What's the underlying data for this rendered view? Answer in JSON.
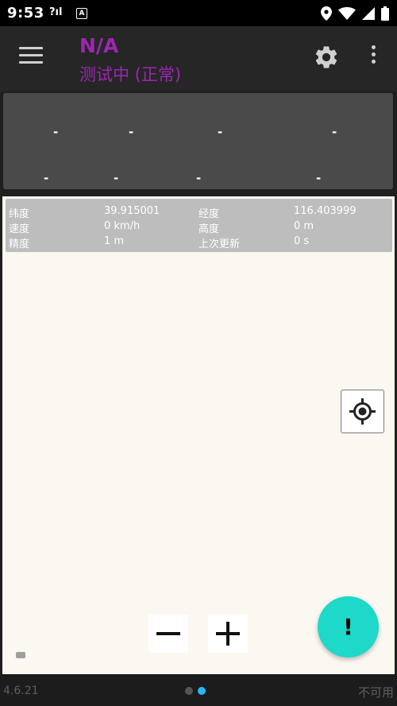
{
  "status_bar": {
    "time": "9:53",
    "signal_label": "?ıl",
    "app_indicator": "A",
    "icons": [
      "location-pin-icon",
      "wifi-icon",
      "cell-signal-icon",
      "battery-icon"
    ]
  },
  "app_bar": {
    "title": "N/A",
    "subtitle": "测试中 (正常)",
    "title_color": "#9c27b0",
    "icons": [
      "menu-icon",
      "gear-icon",
      "more-vert-icon"
    ]
  },
  "stats": {
    "top_values": [
      "-",
      "-",
      "-",
      "-"
    ],
    "bottom_values": [
      "-",
      "-",
      "-",
      "-"
    ]
  },
  "location_info": {
    "latitude_label": "纬度",
    "latitude_value": "39.915001",
    "longitude_label": "经度",
    "longitude_value": "116.403999",
    "speed_label": "速度",
    "speed_value": "0 km/h",
    "altitude_label": "高度",
    "altitude_value": "0 m",
    "accuracy_label": "精度",
    "accuracy_value": "1 m",
    "last_update_label": "上次更新",
    "last_update_value": "0 s"
  },
  "map_controls": {
    "zoom_out": "−",
    "zoom_in": "+",
    "alert_label": "!",
    "fab_color": "#1ed8c9"
  },
  "bottom_bar": {
    "version": "4.6.21",
    "status": "不可用",
    "page_indicator": {
      "count": 2,
      "active": 2,
      "active_color": "#29b6f6",
      "inactive_color": "#555555"
    }
  }
}
